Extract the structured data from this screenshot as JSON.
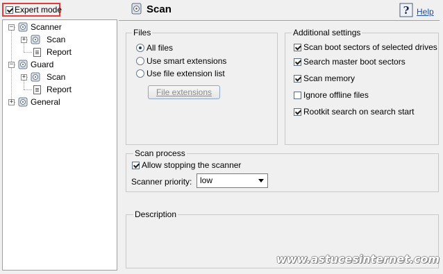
{
  "expert_mode": {
    "label": "Expert mode",
    "checked": true
  },
  "tree": {
    "items": [
      {
        "label": "Scanner"
      },
      {
        "label": "Scan"
      },
      {
        "label": "Report"
      },
      {
        "label": "Guard"
      },
      {
        "label": "Scan"
      },
      {
        "label": "Report"
      },
      {
        "label": "General"
      }
    ]
  },
  "header": {
    "title": "Scan",
    "help_label": "Help"
  },
  "files": {
    "title": "Files",
    "options": [
      {
        "label": "All files",
        "selected": true
      },
      {
        "label": "Use smart extensions",
        "selected": false
      },
      {
        "label": "Use file extension list",
        "selected": false
      }
    ],
    "extensions_button": "File extensions"
  },
  "additional": {
    "title": "Additional settings",
    "items": [
      {
        "label": "Scan boot sectors of selected drives",
        "checked": true
      },
      {
        "label": "Search master boot sectors",
        "checked": true
      },
      {
        "label": "Scan memory",
        "checked": true
      },
      {
        "label": "Ignore offline files",
        "checked": false
      },
      {
        "label": "Rootkit search on search start",
        "checked": true
      }
    ]
  },
  "scan_process": {
    "title": "Scan process",
    "allow_stop": {
      "label": "Allow stopping the scanner",
      "checked": true
    },
    "priority_label": "Scanner priority:",
    "priority_value": "low"
  },
  "description": {
    "title": "Description"
  },
  "watermark": "www.astucesinternet.com",
  "colors": {
    "highlight_border": "#e23b3b",
    "link": "#1a4fa0"
  }
}
